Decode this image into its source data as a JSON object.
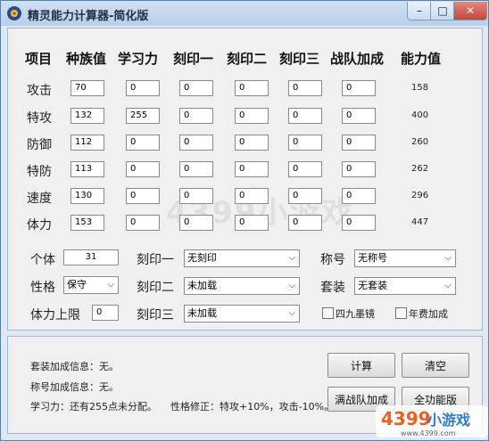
{
  "window": {
    "title": "精灵能力计算器-简化版",
    "close_glyph": "✕",
    "min_glyph": "–",
    "max_glyph": "□"
  },
  "table": {
    "headers": [
      "项目",
      "种族值",
      "学习力",
      "刻印一",
      "刻印二",
      "刻印三",
      "战队加成",
      "能力值"
    ],
    "rows": [
      {
        "label": "攻击",
        "values": [
          "70",
          "0",
          "0",
          "0",
          "0",
          "0"
        ],
        "ability": "158"
      },
      {
        "label": "特攻",
        "values": [
          "132",
          "255",
          "0",
          "0",
          "0",
          "0"
        ],
        "ability": "400"
      },
      {
        "label": "防御",
        "values": [
          "112",
          "0",
          "0",
          "0",
          "0",
          "0"
        ],
        "ability": "260"
      },
      {
        "label": "特防",
        "values": [
          "113",
          "0",
          "0",
          "0",
          "0",
          "0"
        ],
        "ability": "262"
      },
      {
        "label": "速度",
        "values": [
          "130",
          "0",
          "0",
          "0",
          "0",
          "0"
        ],
        "ability": "296"
      },
      {
        "label": "体力",
        "values": [
          "153",
          "0",
          "0",
          "0",
          "0",
          "0"
        ],
        "ability": "447"
      }
    ]
  },
  "settings": {
    "individual_label": "个体",
    "individual_value": "31",
    "nature_label": "性格",
    "nature_value": "保守",
    "hp_limit_label": "体力上限",
    "hp_limit_value": "0",
    "imprint1_label": "刻印一",
    "imprint1_value": "无刻印",
    "imprint2_label": "刻印二",
    "imprint2_value": "未加载",
    "imprint3_label": "刻印三",
    "imprint3_value": "未加载",
    "title_label": "称号",
    "title_value": "无称号",
    "suit_label": "套装",
    "suit_value": "无套装",
    "cb1_label": "四九墨镜",
    "cb2_label": "年费加成"
  },
  "info": {
    "suit_info": "套装加成信息：无。",
    "title_info": "称号加成信息：无。",
    "ev_info": "学习力：还有255点未分配。",
    "nature_info": "性格修正：特攻+10%，攻击-10%。"
  },
  "buttons": {
    "calculate": "计算",
    "clear": "清空",
    "full_team": "满战队加成",
    "full_version": "全功能版"
  },
  "watermark": "4399小游戏",
  "logo": {
    "number": "4399",
    "text": "小游戏",
    "url": "www.4399.com"
  }
}
